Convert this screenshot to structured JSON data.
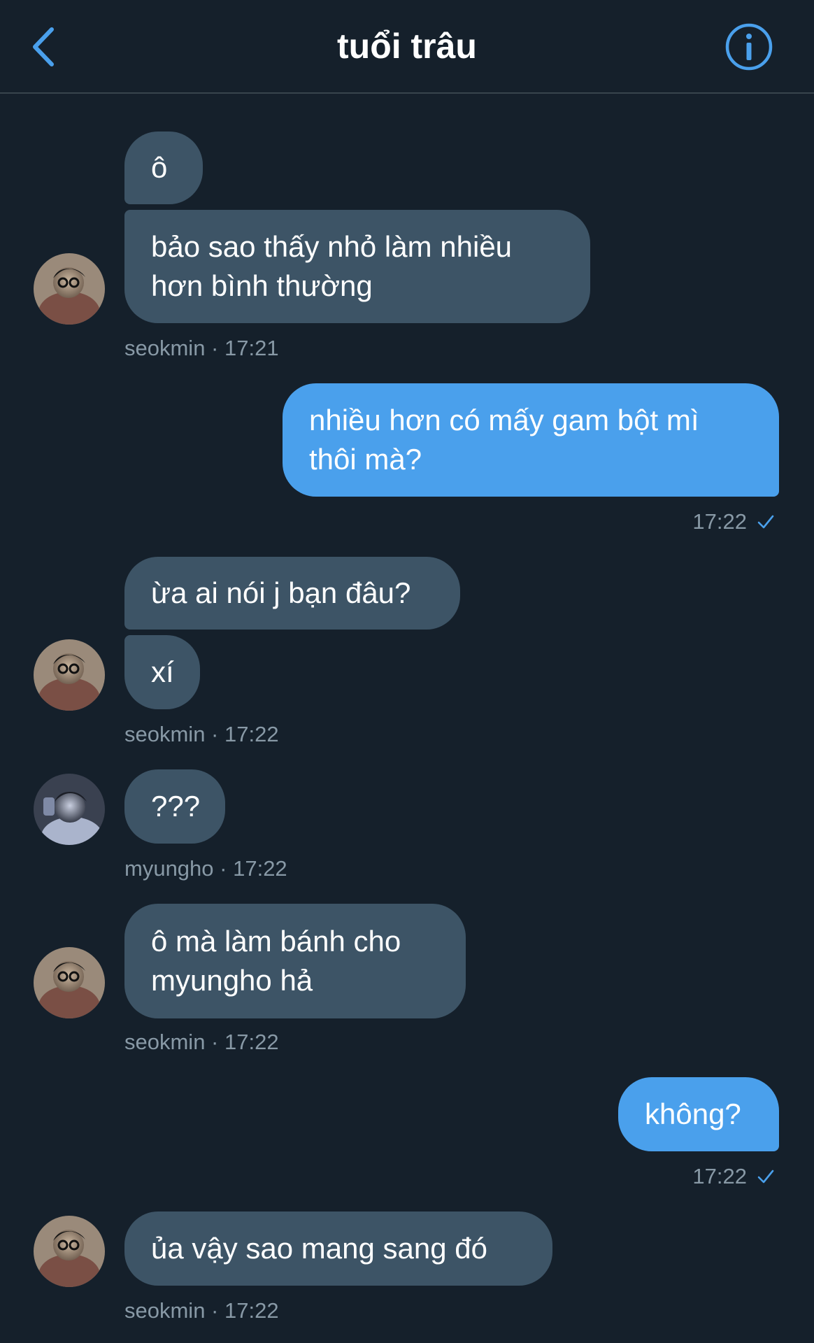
{
  "header": {
    "title": "tuổi trâu",
    "back_icon": "chevron-left-icon",
    "info_icon": "info-icon",
    "accent_color": "#4aa0ec"
  },
  "colors": {
    "background": "#15202b",
    "incoming_bubble": "#3d5466",
    "outgoing_bubble": "#4aa0ec",
    "meta_text": "#8899a6"
  },
  "messages": {
    "m1": {
      "text": "ô"
    },
    "m2": {
      "line1": "bảo sao thấy nhỏ làm nhiều",
      "line2": "hơn bình thường"
    },
    "meta1": {
      "sender": "seokmin",
      "sep": " · ",
      "time": "17:21"
    },
    "m3": {
      "line1": "nhiều hơn có mấy gam bột mì",
      "line2": "thôi mà?"
    },
    "meta2": {
      "time": "17:22"
    },
    "m4": {
      "text": "ừa ai nói j bạn đâu?"
    },
    "m5": {
      "text": "xí"
    },
    "meta3": {
      "sender": "seokmin",
      "sep": " · ",
      "time": "17:22"
    },
    "m6": {
      "text": "???"
    },
    "meta4": {
      "sender": "myungho",
      "sep": " · ",
      "time": "17:22"
    },
    "m7": {
      "line1": "ô mà làm bánh cho",
      "line2": "myungho hả"
    },
    "meta5": {
      "sender": "seokmin",
      "sep": " · ",
      "time": "17:22"
    },
    "m8": {
      "text": "không?"
    },
    "meta6": {
      "time": "17:22"
    },
    "m9": {
      "text": "ủa vậy sao mang sang đó"
    },
    "meta7": {
      "sender": "seokmin",
      "sep": " · ",
      "time": "17:22"
    }
  }
}
